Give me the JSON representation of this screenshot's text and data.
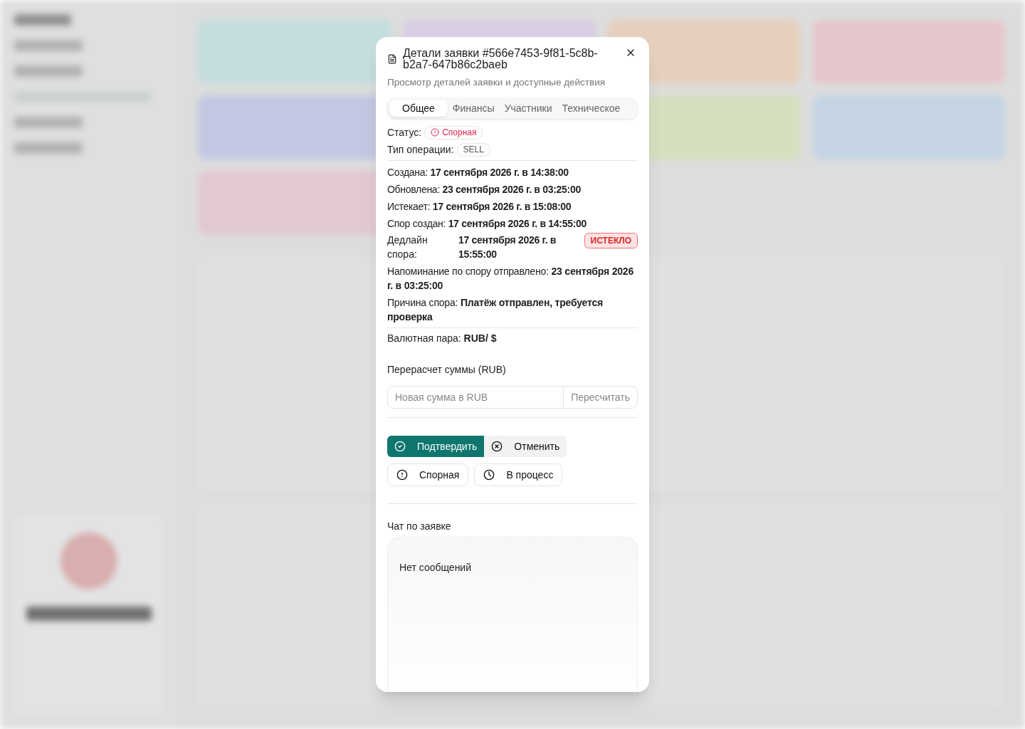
{
  "dialog": {
    "title": "Детали заявки #566e7453-9f81-5c8b-b2a7-647b86c2baeb",
    "subtitle": "Просмотр деталей заявки и доступные действия",
    "tabs": [
      {
        "label": "Общее",
        "selected": true
      },
      {
        "label": "Финансы",
        "selected": false
      },
      {
        "label": "Участники",
        "selected": false
      },
      {
        "label": "Техническое",
        "selected": false
      }
    ],
    "status": {
      "label": "Статус:",
      "value": "Спорная"
    },
    "operation_type": {
      "label": "Тип операции:",
      "value": "SELL"
    },
    "dates": [
      {
        "label": "Создана:",
        "value": "17 сентября 2026 г. в 14:38:00"
      },
      {
        "label": "Обновлена:",
        "value": "23 сентября 2026 г. в 03:25:00"
      },
      {
        "label": "Истекает:",
        "value": "17 сентября 2026 г. в 15:08:00"
      },
      {
        "label": "Спор создан:",
        "value": "17 сентября 2026 г. в 14:55:00"
      }
    ],
    "deadline": {
      "label": "Дедлайн спора:",
      "value": "17 сентября 2026 г. в 15:55:00",
      "badge": "ИСТЕКЛО"
    },
    "notes": [
      {
        "label": "Напоминание по спору отправлено:",
        "value": "23 сентября 2026 г. в 03:25:00"
      },
      {
        "label": "Причина спора:",
        "value": "Платёж отправлен, требуется проверка"
      }
    ],
    "currency_pair": {
      "label": "Валютная пара:",
      "value": "RUB/ $"
    },
    "recalc": {
      "heading": "Перерасчет суммы (RUB)",
      "placeholder": "Новая сумма в RUB",
      "button": "Пересчитать"
    },
    "actions": [
      {
        "label": "Подтвердить",
        "kind": "confirm"
      },
      {
        "label": "Отменить",
        "kind": "cancel"
      },
      {
        "label": "Спорная",
        "kind": "dispute"
      },
      {
        "label": "В процесс",
        "kind": "progress"
      }
    ],
    "chat": {
      "heading": "Чат по заявке",
      "empty": "Нет сообщений"
    }
  }
}
